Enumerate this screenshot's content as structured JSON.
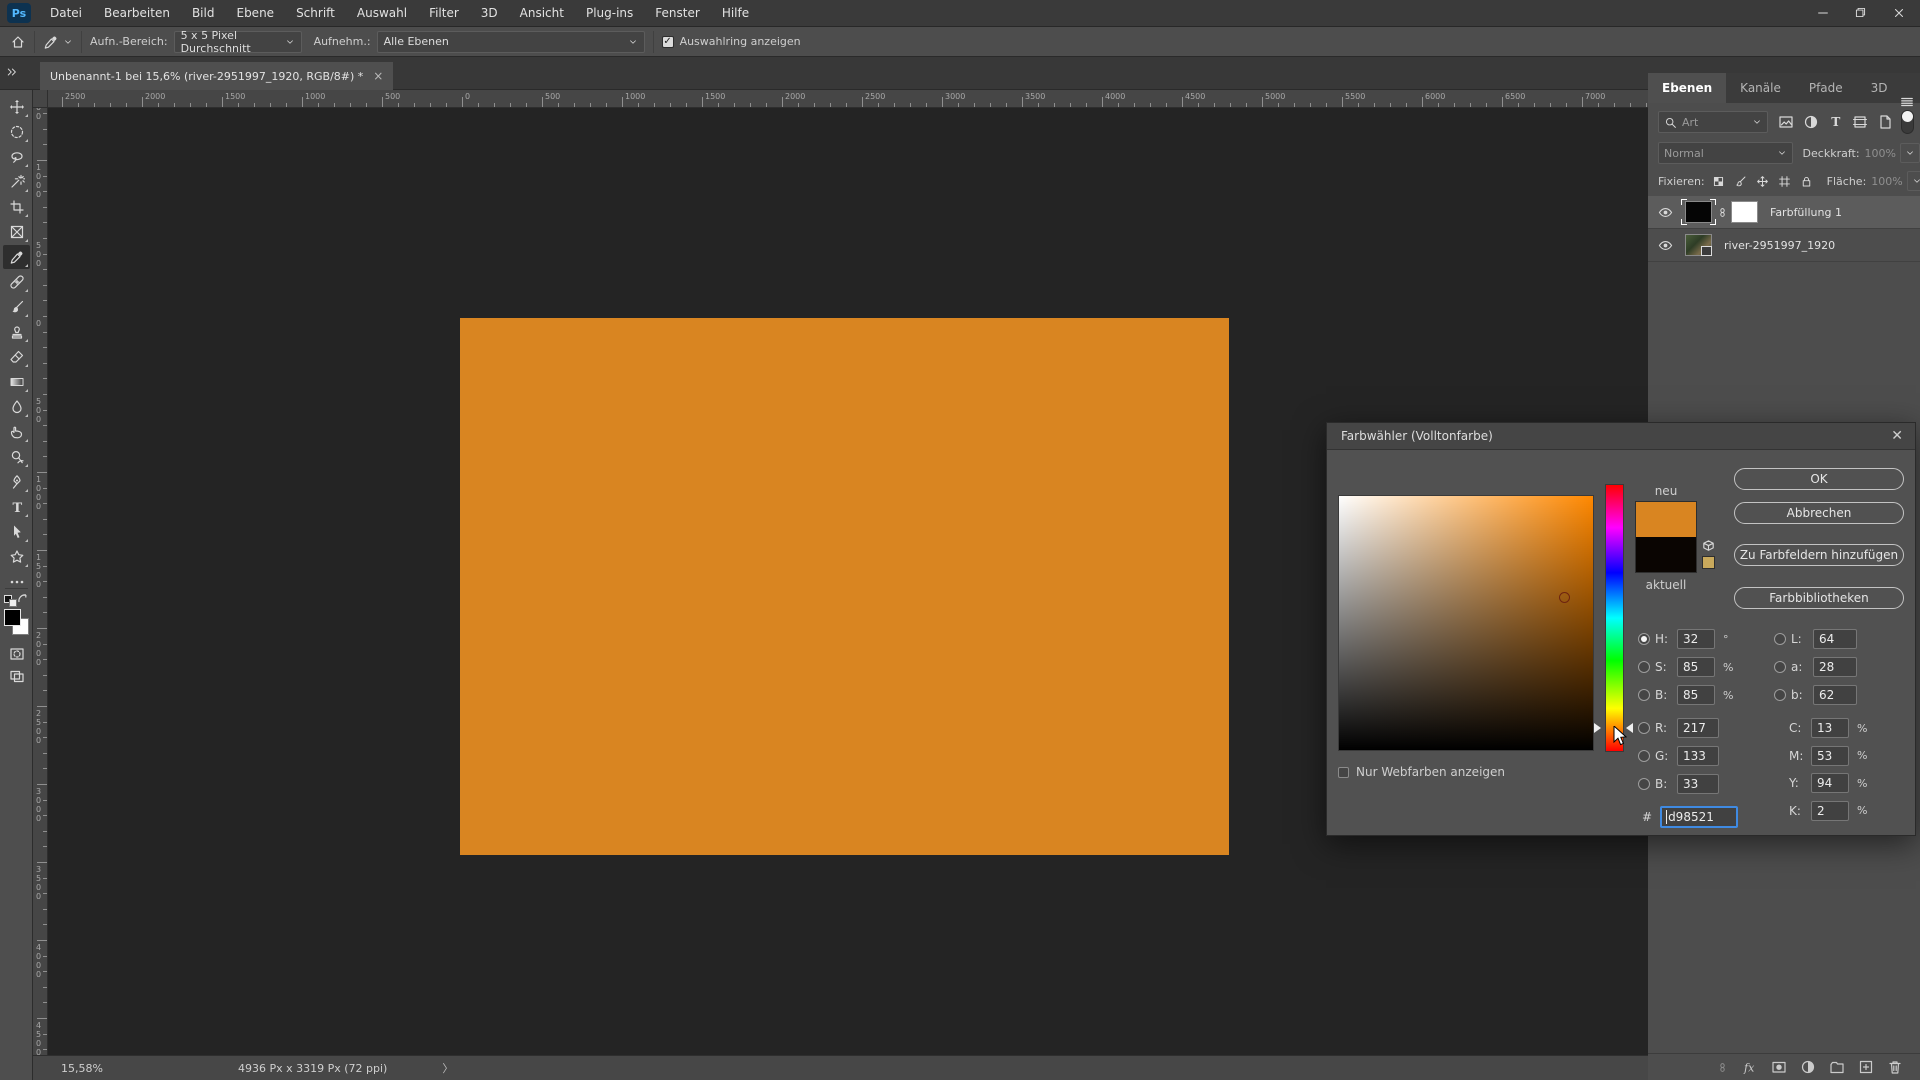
{
  "menubar": {
    "logo": "Ps",
    "items": [
      "Datei",
      "Bearbeiten",
      "Bild",
      "Ebene",
      "Schrift",
      "Auswahl",
      "Filter",
      "3D",
      "Ansicht",
      "Plug-ins",
      "Fenster",
      "Hilfe"
    ]
  },
  "options_bar": {
    "sample_size_label": "Aufn.-Bereich:",
    "sample_size_value": "5 x 5 Pixel Durchschnitt",
    "sample_layers_label": "Aufnehm.:",
    "sample_layers_value": "Alle Ebenen",
    "show_ring_label": "Auswahlring anzeigen",
    "show_ring_checked": true
  },
  "document_tab": {
    "title": "Unbenannt-1 bei 15,6% (river-2951997_1920, RGB/8#) *"
  },
  "rulers": {
    "horizontal_labels": [
      "2500",
      "2000",
      "1500",
      "1000",
      "500",
      "0",
      "500",
      "1000",
      "1500",
      "2000",
      "2500",
      "3000",
      "3500",
      "4000",
      "4500",
      "5000",
      "5500",
      "6000",
      "6500",
      "7000"
    ],
    "vertical_labels": [
      "1500",
      "1000",
      "500",
      "0",
      "500",
      "1000",
      "1500",
      "2000",
      "2500",
      "3000",
      "3500",
      "4000",
      "4500"
    ]
  },
  "toolbar": {
    "tools": [
      {
        "icon": "move-tool"
      },
      {
        "icon": "ellipse-marquee-tool"
      },
      {
        "icon": "lasso-tool"
      },
      {
        "icon": "magic-wand-tool"
      },
      {
        "icon": "crop-tool"
      },
      {
        "icon": "frame-tool"
      },
      {
        "icon": "eyedropper-tool",
        "active": true
      },
      {
        "icon": "healing-brush-tool"
      },
      {
        "icon": "brush-tool"
      },
      {
        "icon": "clone-stamp-tool"
      },
      {
        "icon": "eraser-tool"
      },
      {
        "icon": "gradient-tool"
      },
      {
        "icon": "blur-tool"
      },
      {
        "icon": "smudge-tool"
      },
      {
        "icon": "dodge-tool"
      },
      {
        "icon": "pen-tool"
      },
      {
        "icon": "type-tool"
      },
      {
        "icon": "path-select-tool"
      },
      {
        "icon": "shape-tool"
      },
      {
        "icon": "ellipsis-icon"
      }
    ]
  },
  "canvas": {
    "fill_color": "#d98521"
  },
  "status_bar": {
    "zoom": "15,58%",
    "doc_info": "4936 Px x 3319 Px (72 ppi)"
  },
  "layers_panel": {
    "tabs": [
      "Ebenen",
      "Kanäle",
      "Pfade",
      "3D"
    ],
    "active_tab": "Ebenen",
    "filter_value": "Art",
    "filter_icons": [
      "image-icon",
      "adjustment-icon",
      "type-icon",
      "frame-icon",
      "smartobject-icon"
    ],
    "blend_mode": "Normal",
    "opacity_label": "Deckkraft:",
    "opacity_value": "100%",
    "lock_label": "Fixieren:",
    "lock_icons": [
      "checkerboard-icon",
      "brush-small-icon",
      "move-small-icon",
      "artboard-icon",
      "lock-icon"
    ],
    "fill_label": "Fläche:",
    "fill_value": "100%",
    "layers": [
      {
        "name": "Farbfüllung 1",
        "type": "fill",
        "selected": true,
        "visible": true
      },
      {
        "name": "river-2951997_1920",
        "type": "image",
        "selected": false,
        "visible": true
      }
    ],
    "bottom_icons": [
      "link-icon",
      "fx-icon",
      "mask-icon",
      "adjustment-icon",
      "folder-icon",
      "new-layer-icon",
      "trash-icon"
    ]
  },
  "color_picker": {
    "title": "Farbwähler (Volltonfarbe)",
    "new_label": "neu",
    "current_label": "aktuell",
    "new_color": "#d98521",
    "current_color": "#0a0502",
    "gamut_chip_color": "#c9a95c",
    "buttons": {
      "ok": "OK",
      "cancel": "Abbrechen",
      "add_swatch": "Zu Farbfeldern hinzufügen",
      "libraries": "Farbbibliotheken"
    },
    "hsb": [
      {
        "label": "H:",
        "value": "32",
        "unit": "°",
        "selected": true
      },
      {
        "label": "S:",
        "value": "85",
        "unit": "%"
      },
      {
        "label": "B:",
        "value": "85",
        "unit": "%"
      }
    ],
    "rgb": [
      {
        "label": "R:",
        "value": "217"
      },
      {
        "label": "G:",
        "value": "133"
      },
      {
        "label": "B:",
        "value": "33"
      }
    ],
    "lab": [
      {
        "label": "L:",
        "value": "64"
      },
      {
        "label": "a:",
        "value": "28"
      },
      {
        "label": "b:",
        "value": "62"
      }
    ],
    "cmyk": [
      {
        "label": "C:",
        "value": "13",
        "unit": "%"
      },
      {
        "label": "M:",
        "value": "53",
        "unit": "%"
      },
      {
        "label": "Y:",
        "value": "94",
        "unit": "%"
      },
      {
        "label": "K:",
        "value": "2",
        "unit": "%"
      }
    ],
    "hex_prefix": "#",
    "hex_value": "d98521",
    "web_colors_label": "Nur Webfarben anzeigen",
    "web_colors_checked": false
  },
  "colors": {
    "accent_blue": "#3f8ae2",
    "canvas_fill": "#d98521"
  }
}
